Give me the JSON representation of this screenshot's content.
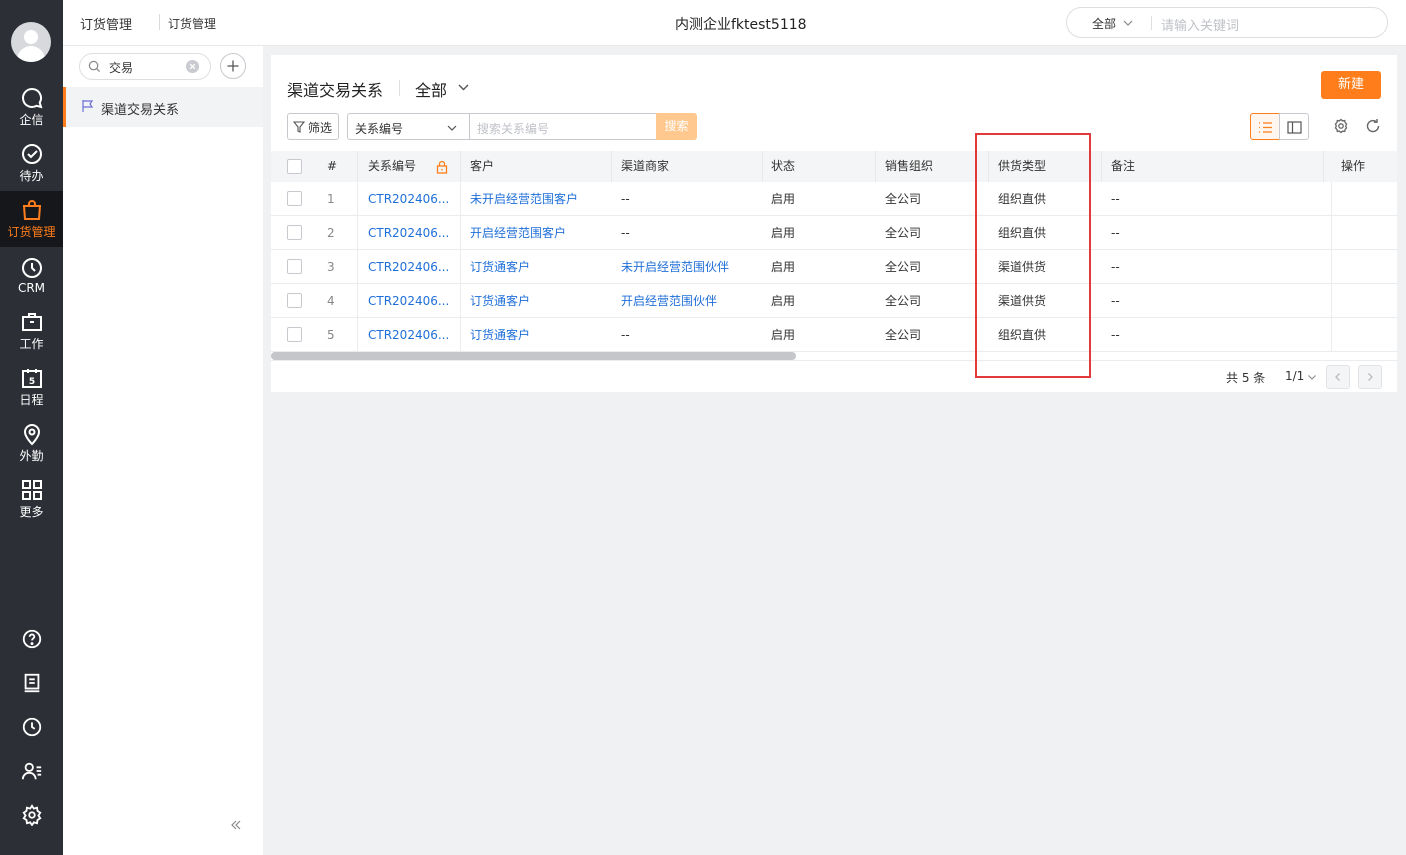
{
  "nav": {
    "items": [
      {
        "label": "企信",
        "icon": "chat-icon"
      },
      {
        "label": "待办",
        "icon": "check-circle-icon"
      },
      {
        "label": "订货管理",
        "icon": "shopping-bag-icon",
        "active": true
      },
      {
        "label": "CRM",
        "icon": "clock-icon"
      },
      {
        "label": "工作",
        "icon": "briefcase-icon"
      },
      {
        "label": "日程",
        "icon": "calendar-icon"
      },
      {
        "label": "外勤",
        "icon": "location-pin-icon"
      },
      {
        "label": "更多",
        "icon": "grid-icon"
      }
    ],
    "calendar_day": "5",
    "accent_color": "#ff7d1a"
  },
  "header": {
    "breadcrumb_app": "订货管理",
    "breadcrumb_page": "订货管理",
    "company": "内测企业fktest5118",
    "search_scope": "全部",
    "search_placeholder": "请输入关键词"
  },
  "sidebar": {
    "search_value": "交易",
    "items": [
      {
        "label": "渠道交易关系"
      }
    ]
  },
  "main": {
    "title": "渠道交易关系",
    "scope": "全部",
    "new_button": "新建",
    "filter_button": "筛选",
    "search_field": "关系编号",
    "search_placeholder": "搜索关系编号",
    "search_button": "搜索"
  },
  "table": {
    "columns": [
      "#",
      "关系编号",
      "客户",
      "渠道商家",
      "状态",
      "销售组织",
      "供货类型",
      "备注",
      "操作"
    ],
    "rows": [
      {
        "num": "1",
        "code": "CTR202406...",
        "customer": "未开启经营范围客户",
        "partner": "--",
        "status": "启用",
        "org": "全公司",
        "supply": "组织直供",
        "remark": "--"
      },
      {
        "num": "2",
        "code": "CTR202406...",
        "customer": "开启经营范围客户",
        "partner": "--",
        "status": "启用",
        "org": "全公司",
        "supply": "组织直供",
        "remark": "--"
      },
      {
        "num": "3",
        "code": "CTR202406...",
        "customer": "订货通客户",
        "partner": "未开启经营范围伙伴",
        "status": "启用",
        "org": "全公司",
        "supply": "渠道供货",
        "remark": "--"
      },
      {
        "num": "4",
        "code": "CTR202406...",
        "customer": "订货通客户",
        "partner": "开启经营范围伙伴",
        "status": "启用",
        "org": "全公司",
        "supply": "渠道供货",
        "remark": "--"
      },
      {
        "num": "5",
        "code": "CTR202406...",
        "customer": "订货通客户",
        "partner": "--",
        "status": "启用",
        "org": "全公司",
        "supply": "组织直供",
        "remark": "--"
      }
    ]
  },
  "pagination": {
    "total": "共 5 条",
    "page": "1/1"
  }
}
